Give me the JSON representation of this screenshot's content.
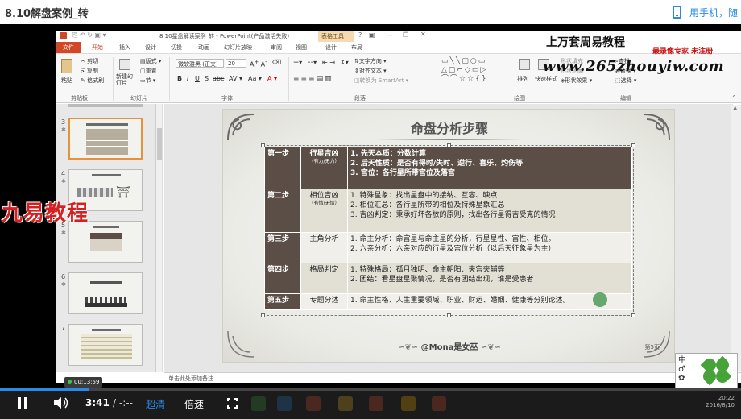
{
  "header": {
    "title": "8.10解盘案例_转",
    "phone_label": "用手机，随"
  },
  "ppt": {
    "window_title": "8.10星盘解读案例_转 - PowerPoint(产品激活失败)",
    "context_tab_group": "表格工具",
    "context_tab": "设计",
    "tabs": [
      "文件",
      "开始",
      "插入",
      "设计",
      "切换",
      "动画",
      "幻灯片放映",
      "审阅",
      "视图",
      "设计",
      "布局"
    ],
    "ribbon": {
      "clipboard": {
        "paste": "粘贴",
        "cut": "剪切",
        "copy": "复制",
        "format_painter": "格式刷",
        "group": "剪贴板"
      },
      "slides": {
        "new_slide": "新建幻灯片",
        "layout": "版式",
        "reset": "重置",
        "section": "节",
        "group": "幻灯片"
      },
      "font": {
        "font_name": "微软雅黑 (正文)",
        "font_size": "20",
        "group": "字体"
      },
      "paragraph": {
        "text_direction": "文字方向",
        "align_text": "对齐文本",
        "smartart": "转换为 SmartArt",
        "group": "段落"
      },
      "drawing": {
        "arrange": "排列",
        "quick_styles": "快速样式",
        "shape_fill": "形状填充",
        "shape_outline": "形状轮廓",
        "shape_effects": "形状效果",
        "group": "绘图"
      },
      "editing": {
        "find": "查找",
        "replace": "替换",
        "select": "选择",
        "group": "编辑"
      }
    },
    "watermark": {
      "line1": "上万套周易教程",
      "line2": "最录像专家 未注册",
      "line3": "www.265zhouyiw.com"
    },
    "thumbnails": [
      {
        "num": "3"
      },
      {
        "num": "4"
      },
      {
        "num": "5"
      },
      {
        "num": "6"
      },
      {
        "num": "7"
      }
    ],
    "slide": {
      "title": "命盘分析步骤",
      "rows": [
        {
          "step": "第一步",
          "name": "行星吉凶",
          "sub": "（有力/无力）",
          "lines": [
            "1. 先天本质：分数计算",
            "2. 后天性质：是否有得时/失时、逆行、喜乐、灼伤等",
            "3. 宫位：各行星所带宫位及落宫"
          ]
        },
        {
          "step": "第二步",
          "name": "相位吉凶",
          "sub": "（有情/无情）",
          "lines": [
            "1. 特殊星象：找出星盘中的接纳、互容、映点",
            "2. 相位汇总：各行星所带的相位及特殊星象汇总",
            "3. 吉凶判定：秉承好坏各放的原则，找出各行星得吉受克的情况"
          ]
        },
        {
          "step": "第三步",
          "name": "主角分析",
          "sub": "",
          "lines": [
            "1. 命主分析：命宫星与命主星的分析，行星星性、宫性、相位。",
            "2. 六亲分析：六亲对应的行星及宫位分析（以后天征象星为主）"
          ]
        },
        {
          "step": "第四步",
          "name": "格局判定",
          "sub": "",
          "lines": [
            "1. 特殊格局：孤月独明、命主朝阳、夹宫夹辅等",
            "2. 团结：看星盘星聚情况，是否有团结出现，谁是受患者"
          ]
        },
        {
          "step": "第五步",
          "name": "专题分述",
          "sub": "",
          "lines": [
            "1. 命主性格、人生重要领域、职业、财运、婚姻、健康等分别论述。"
          ]
        }
      ],
      "footer": "@Mona是女巫",
      "page_label": "第5页"
    },
    "notes_placeholder": "单击此处添加备注"
  },
  "left_watermark": "九易教程",
  "clover_text": "中\n♂\n✿",
  "player": {
    "current_time": "3:41",
    "total_time": "/ -:--",
    "quality": "超清",
    "speed": "倍速",
    "elapsed_chip": "00:13:59",
    "progress": 0.12,
    "tray_time": "20:22",
    "tray_date": "2016/8/10"
  },
  "colors": {
    "accent": "#2a8ae8",
    "ppt_orange": "#d24726",
    "table_dark": "#5b4e46",
    "watermark_red": "#d42020"
  }
}
